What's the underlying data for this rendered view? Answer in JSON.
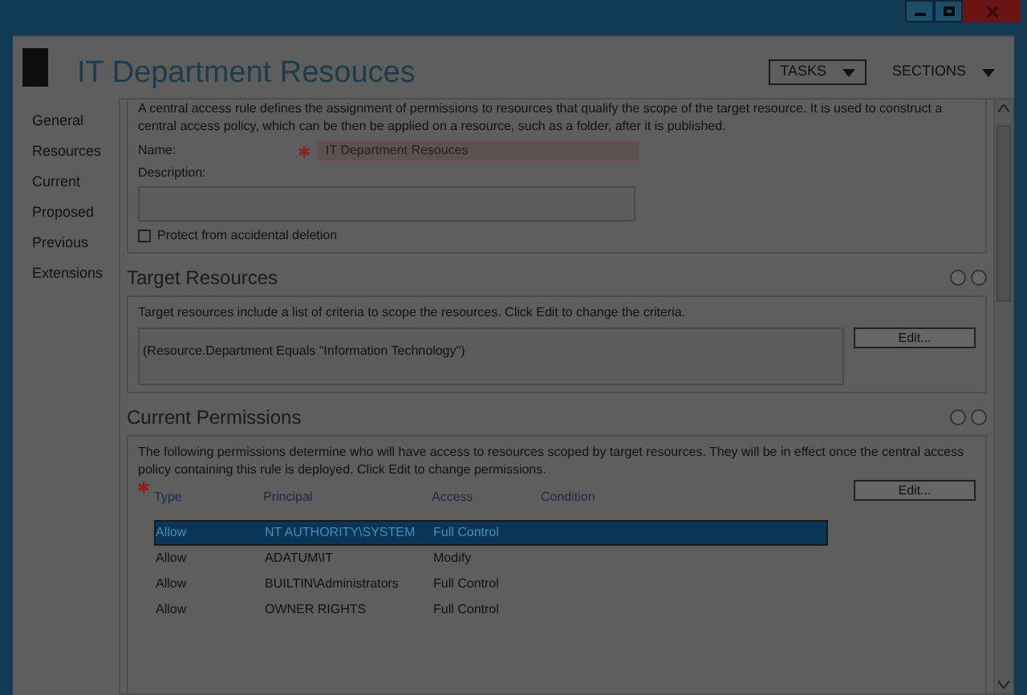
{
  "window": {
    "title": "IT Department Resouces"
  },
  "header_buttons": [
    {
      "label": "TASKS",
      "kind": "boxed"
    },
    {
      "label": "SECTIONS",
      "kind": "plain"
    }
  ],
  "sidebar": {
    "items": [
      {
        "label": "General"
      },
      {
        "label": "Resources"
      },
      {
        "label": "Current"
      },
      {
        "label": "Proposed"
      },
      {
        "label": "Previous"
      },
      {
        "label": "Extensions"
      }
    ]
  },
  "general": {
    "description": "A central access rule defines the assignment of permissions to resources that qualify the scope of the target resource. It is used to construct a central access policy, which can be then be applied on a resource, such as a folder, after it is published.",
    "name_label": "Name:",
    "name_value": "IT Department Resouces",
    "description_label": "Description:",
    "protect": {
      "label": "Protect from accidental deletion",
      "checked": false
    }
  },
  "target_resources": {
    "title": "Target Resources",
    "info": "Target resources include a list of criteria to scope the resources. Click Edit to change the criteria.",
    "criteria": "(Resource.Department Equals \"Information Technology\")",
    "edit_button": "Edit..."
  },
  "current_permissions": {
    "title": "Current Permissions",
    "info": "The following permissions determine who will have access to resources scoped by target resources. They will be in effect once the central access policy containing this rule is deployed. Click Edit to change permissions.",
    "edit_button": "Edit...",
    "columns": [
      "Type",
      "Principal",
      "Access",
      "Condition"
    ],
    "rows": [
      {
        "cells": [
          "Allow",
          "NT AUTHORITY\\SYSTEM",
          "Full Control"
        ],
        "selected": true
      },
      {
        "cells": [
          "Allow",
          "ADATUM\\IT",
          "Modify"
        ],
        "selected": false
      },
      {
        "cells": [
          "Allow",
          "BUILTIN\\Administrators",
          "Full Control"
        ],
        "selected": false
      },
      {
        "cells": [
          "Allow",
          "OWNER RIGHTS",
          "Full Control"
        ],
        "selected": false
      }
    ]
  }
}
